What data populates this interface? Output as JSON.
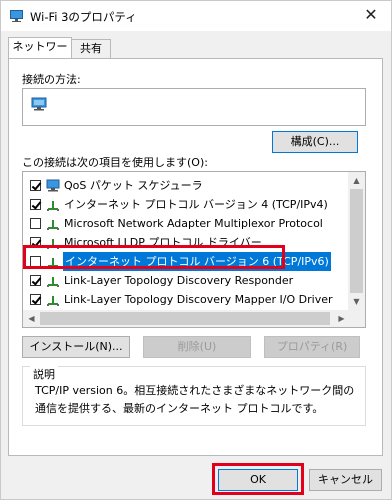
{
  "window": {
    "title": "Wi-Fi 3のプロパティ",
    "close_glyph": "✕"
  },
  "tabs": [
    {
      "label": "ネットワーク"
    },
    {
      "label": "共有"
    }
  ],
  "connect_method": {
    "label": "接続の方法:"
  },
  "configure_button": {
    "label": "構成(C)..."
  },
  "items_label": "この接続は次の項目を使用します(O):",
  "items": [
    {
      "checked": true,
      "icon": "qos-icon",
      "label": "QoS パケット スケジューラ"
    },
    {
      "checked": true,
      "icon": "protocol-icon",
      "label": "インターネット プロトコル バージョン 4 (TCP/IPv4)"
    },
    {
      "checked": false,
      "icon": "protocol-icon",
      "label": "Microsoft Network Adapter Multiplexor Protocol"
    },
    {
      "checked": true,
      "icon": "protocol-icon",
      "label": "Microsoft LLDP プロトコル ドライバー"
    },
    {
      "checked": false,
      "icon": "protocol-icon",
      "label": "インターネット プロトコル バージョン 6 (TCP/IPv6)",
      "selected": true
    },
    {
      "checked": true,
      "icon": "protocol-icon",
      "label": "Link-Layer Topology Discovery Responder"
    },
    {
      "checked": true,
      "icon": "protocol-icon",
      "label": "Link-Layer Topology Discovery Mapper I/O Driver"
    }
  ],
  "buttons": {
    "install": "インストール(N)...",
    "uninstall": "削除(U)",
    "properties": "プロパティ(R)",
    "ok": "OK",
    "cancel": "キャンセル"
  },
  "description": {
    "title": "説明",
    "text": "TCP/IP version 6。相互接続されたさまざまなネットワーク間の通信を提供する、最新のインターネット プロトコルです。"
  },
  "colors": {
    "highlight": "#e3001b",
    "selection": "#0078d7"
  }
}
